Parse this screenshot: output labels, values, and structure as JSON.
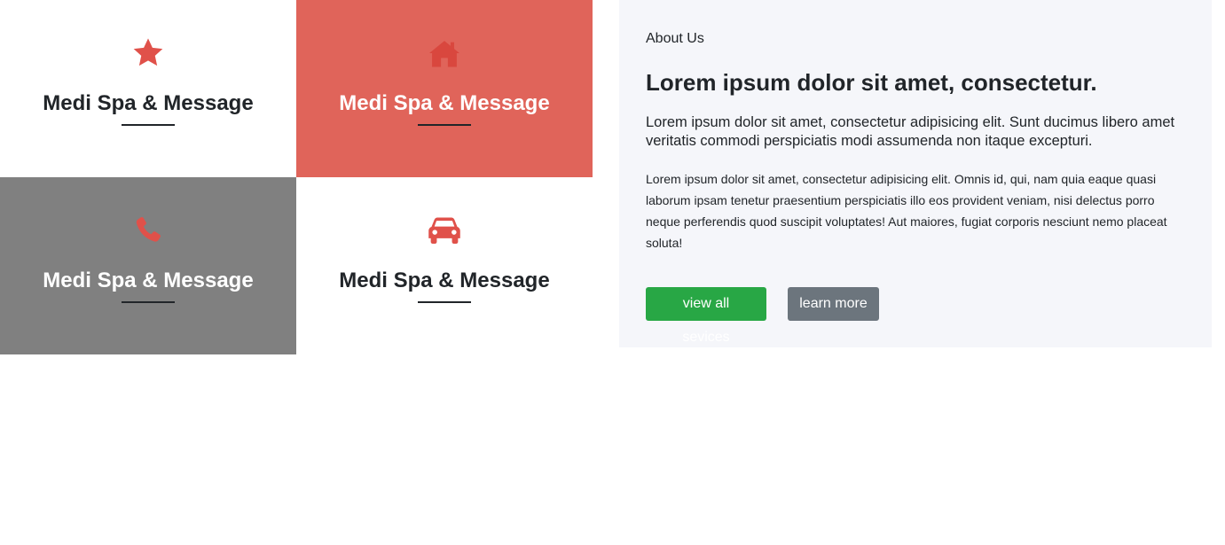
{
  "colors": {
    "accent_red": "#e0645a",
    "icon_red": "#e0514a",
    "tile_gray": "#808080",
    "panel_bg": "#f5f6fa",
    "button_green": "#28a745",
    "button_gray": "#6c757d",
    "text_dark": "#212529"
  },
  "tiles": [
    {
      "icon": "star-icon",
      "title": "Medi Spa & Message"
    },
    {
      "icon": "home-icon",
      "title": "Medi Spa & Message"
    },
    {
      "icon": "phone-icon",
      "title": "Medi Spa & Message"
    },
    {
      "icon": "car-icon",
      "title": "Medi Spa & Message"
    }
  ],
  "about": {
    "eyebrow": "About Us",
    "heading": "Lorem ipsum dolor sit amet, consectetur.",
    "lead": "Lorem ipsum dolor sit amet, consectetur adipisicing elit. Sunt ducimus libero amet veritatis commodi perspiciatis modi assumenda non itaque excepturi.",
    "body": "Lorem ipsum dolor sit amet, consectetur adipisicing elit. Omnis id, qui, nam quia eaque quasi laborum ipsam tenetur praesentium perspiciatis illo eos provident veniam, nisi delectus porro neque perferendis quod suscipit voluptates! Aut maiores, fugiat corporis nesciunt nemo placeat soluta!",
    "buttons": {
      "primary": "view all sevices",
      "secondary": "learn more"
    }
  }
}
